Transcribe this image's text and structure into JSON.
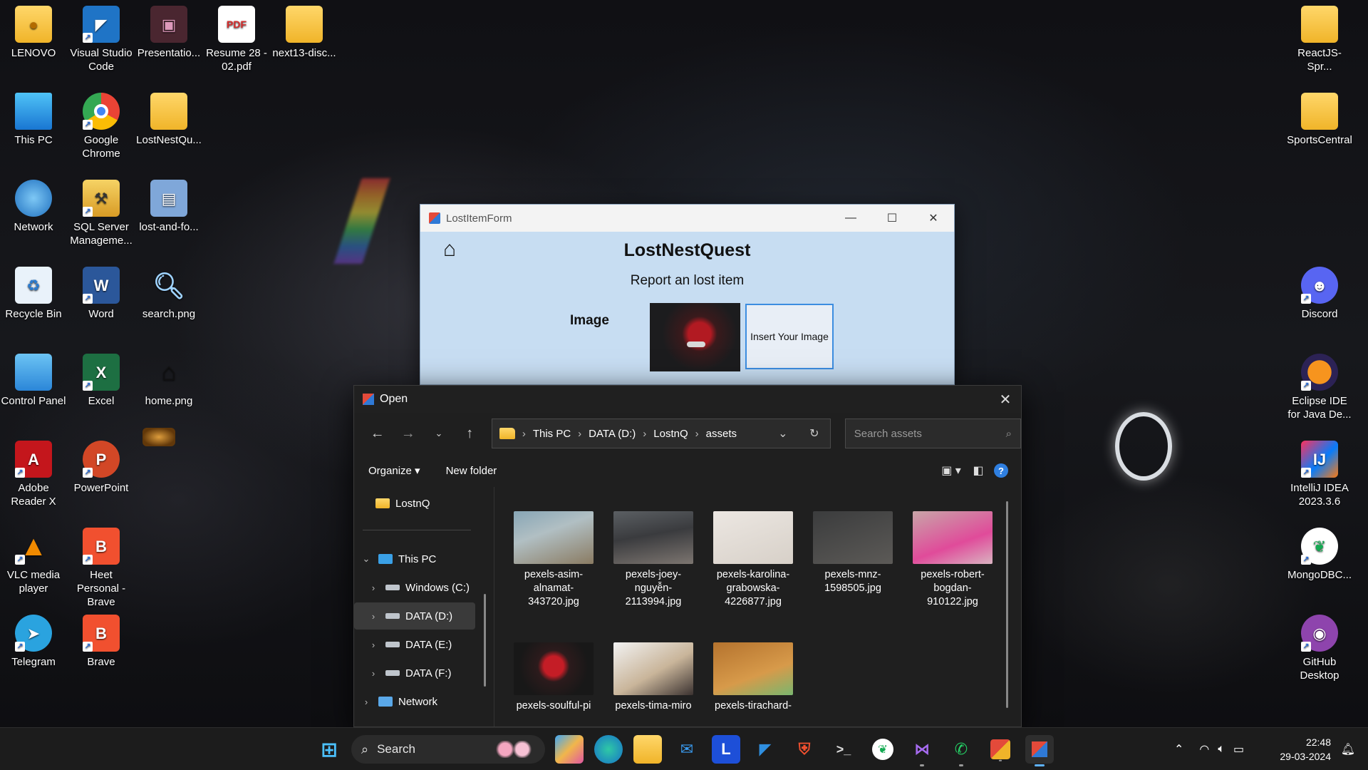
{
  "desktop": {
    "left_icons": [
      {
        "label": "LENOVO",
        "icon": "user-folder-icon"
      },
      {
        "label": "Visual Studio Code",
        "icon": "vscode-icon"
      },
      {
        "label": "Presentatio...",
        "icon": "presentation-icon"
      },
      {
        "label": "Resume 28 - 02.pdf",
        "icon": "pdf-icon"
      },
      {
        "label": "next13-disc...",
        "icon": "folder-icon"
      },
      {
        "label": "This PC",
        "icon": "monitor-icon"
      },
      {
        "label": "Google Chrome",
        "icon": "chrome-icon"
      },
      {
        "label": "LostNestQu...",
        "icon": "folder-icon"
      },
      {
        "label": "Network",
        "icon": "network-icon"
      },
      {
        "label": "SQL Server Manageme...",
        "icon": "sql-server-icon"
      },
      {
        "label": "lost-and-fo...",
        "icon": "file-icon"
      },
      {
        "label": "Recycle Bin",
        "icon": "recycle-bin-icon"
      },
      {
        "label": "Word",
        "icon": "word-icon"
      },
      {
        "label": "search.png",
        "icon": "magnifier-icon"
      },
      {
        "label": "Control Panel",
        "icon": "control-panel-icon"
      },
      {
        "label": "Excel",
        "icon": "excel-icon"
      },
      {
        "label": "home.png",
        "icon": "home-icon"
      },
      {
        "label": "Adobe Reader X",
        "icon": "adobe-reader-icon"
      },
      {
        "label": "PowerPoint",
        "icon": "powerpoint-icon"
      },
      {
        "label": "VLC media player",
        "icon": "vlc-icon"
      },
      {
        "label": "Heet Personal - Brave",
        "icon": "brave-icon"
      },
      {
        "label": "Telegram",
        "icon": "telegram-icon"
      },
      {
        "label": "Brave",
        "icon": "brave-icon"
      }
    ],
    "right_icons": [
      {
        "label": "ReactJS-Spr...",
        "icon": "folder-icon"
      },
      {
        "label": "SportsCentral",
        "icon": "folder-icon"
      },
      {
        "label": "Discord",
        "icon": "discord-icon"
      },
      {
        "label": "Eclipse IDE for Java De...",
        "icon": "eclipse-icon"
      },
      {
        "label": "IntelliJ IDEA 2023.3.6",
        "icon": "intellij-icon"
      },
      {
        "label": "MongoDBC...",
        "icon": "mongodb-icon"
      },
      {
        "label": "GitHub Desktop",
        "icon": "github-icon"
      }
    ]
  },
  "app_window": {
    "title": "LostItemForm",
    "heading": "LostNestQuest",
    "subheading": "Report an lost item",
    "image_label": "Image",
    "insert_button": "Insert Your Image",
    "minimize": "—",
    "maximize": "☐",
    "close": "✕"
  },
  "open_dialog": {
    "title": "Open",
    "close": "✕",
    "breadcrumb": [
      "This PC",
      "DATA (D:)",
      "LostnQ",
      "assets"
    ],
    "search_placeholder": "Search assets",
    "organize": "Organize",
    "new_folder": "New folder",
    "help": "?",
    "tree": [
      {
        "label": "LostnQ",
        "icon": "folder-icon"
      },
      {
        "label": "This PC",
        "icon": "pc-icon",
        "expanded": true
      },
      {
        "label": "Windows (C:)",
        "icon": "drive-icon"
      },
      {
        "label": "DATA (D:)",
        "icon": "drive-icon",
        "selected": true
      },
      {
        "label": "DATA (E:)",
        "icon": "drive-icon"
      },
      {
        "label": "DATA (F:)",
        "icon": "drive-icon"
      },
      {
        "label": "Network",
        "icon": "network-icon"
      }
    ],
    "files": [
      {
        "name": "pexels-asim-alnamat-343720.jpg"
      },
      {
        "name": "pexels-joey-nguyễn-2113994.jpg"
      },
      {
        "name": "pexels-karolina-grabowska-4226877.jpg"
      },
      {
        "name": "pexels-mnz-1598505.jpg"
      },
      {
        "name": "pexels-robert-bogdan-910122.jpg"
      },
      {
        "name": "pexels-soulful-pi"
      },
      {
        "name": "pexels-tima-miro"
      },
      {
        "name": "pexels-tirachard-"
      }
    ]
  },
  "taskbar": {
    "search_label": "Search",
    "apps": [
      "windows-start-icon",
      "copilot-icon",
      "edge-icon",
      "file-explorer-icon",
      "mail-icon",
      "l-app-icon",
      "vscode-icon",
      "brave-icon",
      "terminal-icon",
      "mongodb-icon",
      "visual-studio-icon",
      "whatsapp-icon",
      "app-icon",
      "app-icon"
    ],
    "time": "22:48",
    "date": "29-03-2024"
  }
}
